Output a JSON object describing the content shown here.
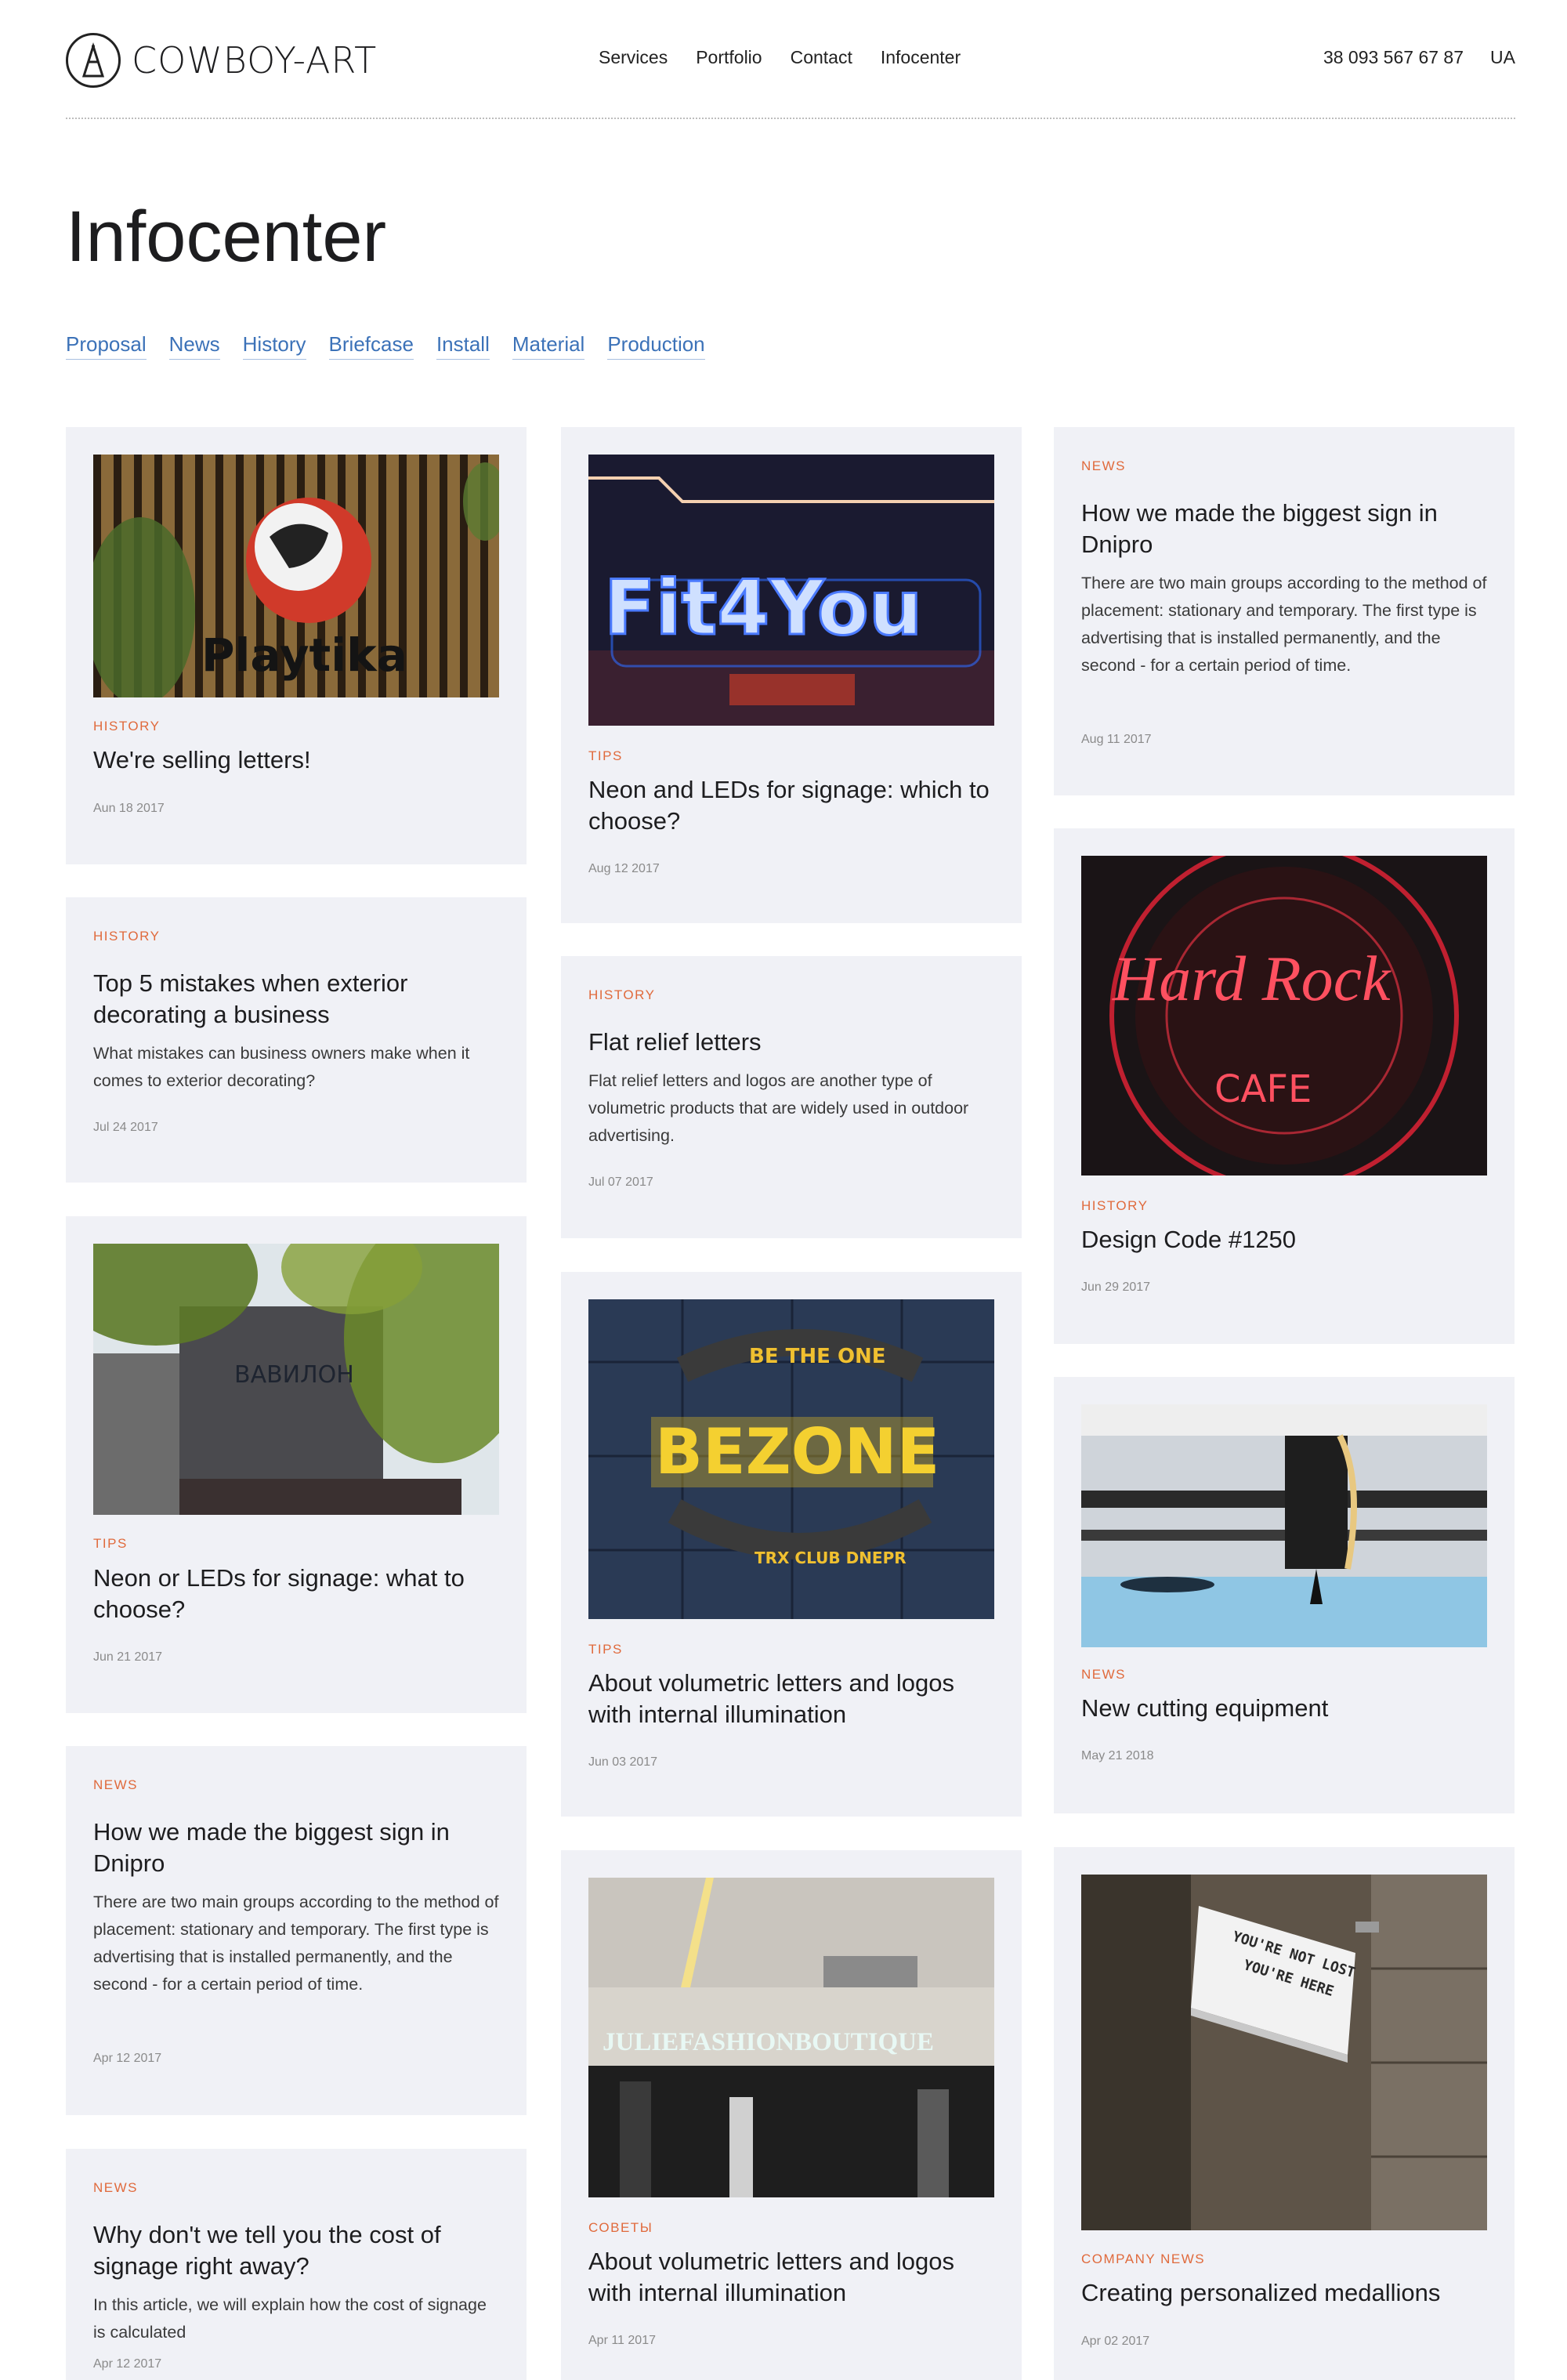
{
  "header": {
    "logo_text": "COWBOY-ART",
    "nav": [
      "Services",
      "Portfolio",
      "Contact",
      "Infocenter"
    ],
    "phone": "38 093 567 67 87",
    "lang": "UA"
  },
  "page_title": "Infocenter",
  "filters": [
    "Proposal",
    "News",
    "History",
    "Briefcase",
    "Install",
    "Material",
    "Production"
  ],
  "cards": [
    {
      "tag": "HISTORY",
      "title": "We're selling letters!",
      "desc": "",
      "date": "Aun 18 2017",
      "image": "Playtika"
    },
    {
      "tag": "HISTORY",
      "title": "Top 5 mistakes when exterior decorating a business",
      "desc": "What mistakes can business owners make when it comes to exterior decorating?",
      "date": "Jul 24 2017"
    },
    {
      "tag": "TIPS",
      "title": "Neon or LEDs for signage: what to choose?",
      "desc": "",
      "date": "Jun 21 2017",
      "image": "ВАВИЛОН"
    },
    {
      "tag": "NEWS",
      "title": "How we made the biggest sign in Dnipro",
      "desc": "There are two main groups according to the method of placement: stationary and temporary. The first type is advertising that is installed permanently, and the second - for a certain period of time.",
      "date": "Apr 12 2017"
    },
    {
      "tag": "NEWS",
      "title": "Why don't we tell you the cost of signage right away?",
      "desc": "In this article, we will explain how the cost of signage is calculated",
      "date": "Apr 12 2017"
    },
    {
      "tag": "TIPS",
      "title": "Neon and LEDs for signage: which to choose?",
      "desc": "",
      "date": "Aug 12 2017",
      "image": "Fit4You"
    },
    {
      "tag": "HISTORY",
      "title": "Flat relief letters",
      "desc": "Flat relief letters and logos are another type of volumetric products that are widely used in outdoor advertising.",
      "date": "Jul 07 2017"
    },
    {
      "tag": "TIPS",
      "title": "About volumetric letters and logos with internal illumination",
      "desc": "",
      "date": "Jun 03 2017",
      "image_lines": [
        "BE THE ONE",
        "BEZONE",
        "TRX CLUB DNEPR"
      ]
    },
    {
      "tag": "СОВЕТЫ",
      "title": "About volumetric letters and logos with internal illumination",
      "desc": "",
      "date": "Apr 11 2017",
      "image": "JULIEFASHIONBOUTIQUE"
    },
    {
      "tag": "NEWS",
      "title": "How we made the biggest sign in Dnipro",
      "desc": "There are two main groups according to the method of placement: stationary and temporary. The first type is advertising that is installed permanently, and the second - for a certain period of time.",
      "date": "Aug 11 2017"
    },
    {
      "tag": "HISTORY",
      "title": "Design Code #1250",
      "desc": "",
      "date": "Jun 29 2017",
      "image_lines": [
        "Hard Rock",
        "CAFE"
      ]
    },
    {
      "tag": "NEWS",
      "title": "New cutting equipment",
      "desc": "",
      "date": "May 21 2018"
    },
    {
      "tag": "COMPANY NEWS",
      "title": "Creating personalized medallions",
      "desc": "",
      "date": "Apr 02 2017",
      "image_lines": [
        "YOU'RE NOT LOST",
        "YOU'RE HERE"
      ]
    }
  ],
  "colors": {
    "accent_tag": "#e06a3c",
    "link": "#3c72b8",
    "card_bg": "#f0f1f6"
  }
}
